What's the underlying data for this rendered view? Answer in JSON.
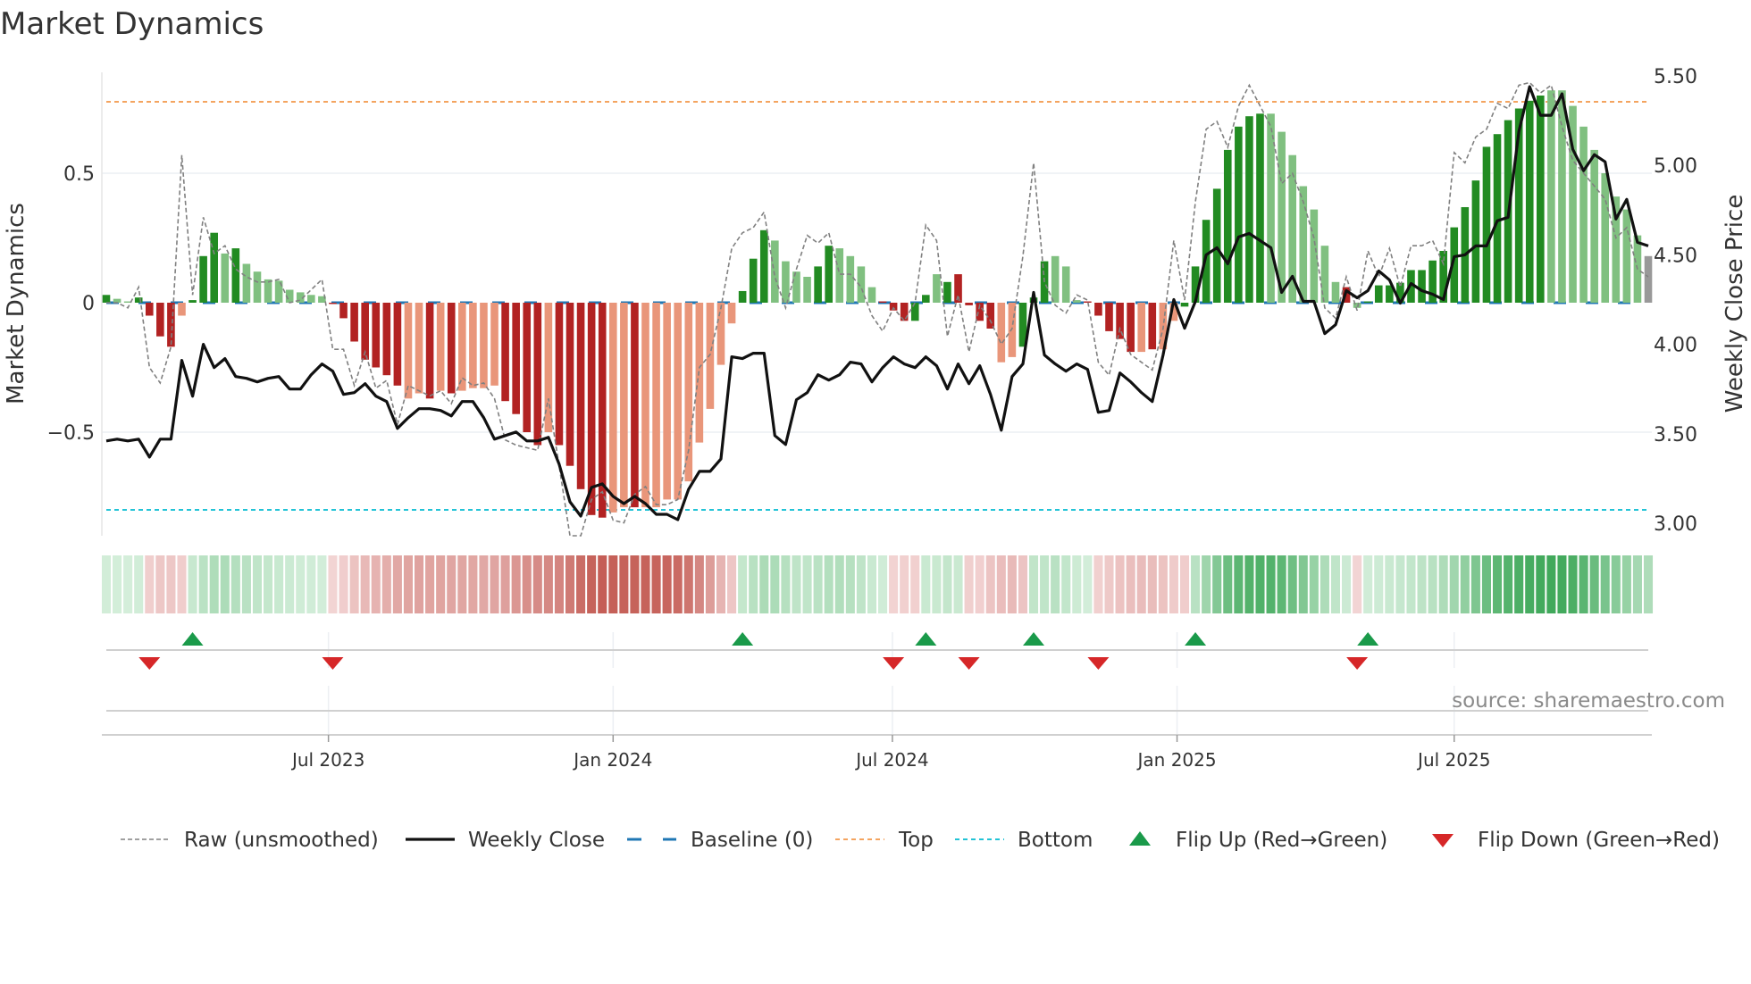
{
  "chart_data": {
    "type": "bar",
    "title": "Market Dynamics",
    "ylabel": "Market Dynamics",
    "y2label": "Weekly Close Price",
    "frequency": "weekly",
    "ylim": [
      -0.93,
      0.9
    ],
    "y2lim": [
      2.93,
      5.6
    ],
    "yticks": [
      {
        "v": 0.5,
        "label": "0.5"
      },
      {
        "v": 0,
        "label": "0"
      },
      {
        "v": -0.5,
        "label": "−0.5"
      }
    ],
    "y2ticks": [
      {
        "v": 5.5,
        "label": "5.50"
      },
      {
        "v": 5.0,
        "label": "5.00"
      },
      {
        "v": 4.5,
        "label": "4.50"
      },
      {
        "v": 4.0,
        "label": "4.00"
      },
      {
        "v": 3.5,
        "label": "3.50"
      },
      {
        "v": 3.0,
        "label": "3.00"
      }
    ],
    "xticks": [
      {
        "week": 20.6,
        "label": "Jul 2023"
      },
      {
        "week": 47.0,
        "label": "Jan 2024"
      },
      {
        "week": 72.9,
        "label": "Jul 2024"
      },
      {
        "week": 99.3,
        "label": "Jan 2025"
      },
      {
        "week": 125.0,
        "label": "Jul 2025"
      }
    ],
    "top_level": 0.776,
    "bottom_level": -0.8,
    "baseline": 0,
    "momentum": [
      0.03,
      0.015,
      0.005,
      0.02,
      -0.05,
      -0.13,
      -0.17,
      -0.05,
      0.01,
      0.18,
      0.27,
      0.19,
      0.21,
      0.15,
      0.12,
      0.09,
      0.085,
      0.05,
      0.04,
      0.03,
      0.025,
      -0.005,
      -0.06,
      -0.15,
      -0.22,
      -0.25,
      -0.28,
      -0.32,
      -0.37,
      -0.35,
      -0.37,
      -0.34,
      -0.35,
      -0.34,
      -0.33,
      -0.33,
      -0.32,
      -0.38,
      -0.43,
      -0.5,
      -0.55,
      -0.5,
      -0.55,
      -0.63,
      -0.72,
      -0.82,
      -0.83,
      -0.81,
      -0.79,
      -0.79,
      -0.79,
      -0.79,
      -0.76,
      -0.76,
      -0.69,
      -0.54,
      -0.41,
      -0.24,
      -0.08,
      0.045,
      0.17,
      0.28,
      0.24,
      0.16,
      0.12,
      0.1,
      0.14,
      0.22,
      0.21,
      0.18,
      0.14,
      0.06,
      0.005,
      -0.03,
      -0.07,
      -0.07,
      0.03,
      0.11,
      0.08,
      0.11,
      -0.01,
      -0.07,
      -0.1,
      -0.23,
      -0.21,
      -0.17,
      0.02,
      0.16,
      0.18,
      0.14,
      0.01,
      0.005,
      -0.05,
      -0.11,
      -0.14,
      -0.19,
      -0.19,
      -0.18,
      -0.18,
      -0.07,
      -0.015,
      0.14,
      0.32,
      0.44,
      0.59,
      0.68,
      0.72,
      0.73,
      0.73,
      0.66,
      0.57,
      0.45,
      0.36,
      0.22,
      0.08,
      0.06,
      -0.02,
      0.005,
      0.067,
      0.067,
      0.077,
      0.126,
      0.126,
      0.163,
      0.2,
      0.291,
      0.369,
      0.472,
      0.602,
      0.651,
      0.705,
      0.75,
      0.78,
      0.8,
      0.82,
      0.82,
      0.76,
      0.68,
      0.59,
      0.5,
      0.41,
      0.36,
      0.26,
      0.18
    ],
    "bar_state": "GggGRRRrGGGgGggggggggRRRRRRRrrRrRrrrrRRRRrRRRRRrrRrrrrrrrrrGGGggggGGggggRRRGGgGRRRRrrGGGgggRRRRRrRrrGGGGGGGGgggggggRgGGGGGGGGGGGGGGGGGggggggggg",
    "bar_state_legend": {
      "G": "green rising",
      "g": "green fading",
      "R": "red rising",
      "r": "red fading"
    },
    "raw": [
      0,
      0,
      -0.02,
      0.06,
      -0.25,
      -0.31,
      -0.17,
      0.57,
      0.03,
      0.33,
      0.19,
      0.22,
      0.13,
      0.1,
      0.08,
      0.08,
      0.09,
      0,
      0.01,
      0.05,
      0.09,
      -0.18,
      -0.18,
      -0.32,
      -0.19,
      -0.33,
      -0.3,
      -0.47,
      -0.32,
      -0.34,
      -0.36,
      -0.34,
      -0.39,
      -0.29,
      -0.32,
      -0.31,
      -0.37,
      -0.53,
      -0.55,
      -0.56,
      -0.57,
      -0.37,
      -0.63,
      -0.9,
      -0.9,
      -0.76,
      -0.73,
      -0.84,
      -0.85,
      -0.74,
      -0.71,
      -0.78,
      -0.78,
      -0.76,
      -0.57,
      -0.25,
      -0.2,
      -0.02,
      0.21,
      0.27,
      0.29,
      0.35,
      0.1,
      -0.02,
      0.13,
      0.26,
      0.23,
      0.27,
      0.11,
      0.11,
      0.06,
      -0.05,
      -0.11,
      -0.02,
      -0.07,
      0,
      0.3,
      0.24,
      -0.13,
      0.03,
      -0.19,
      -0.01,
      -0.07,
      -0.16,
      -0.1,
      0.18,
      0.54,
      0.08,
      -0.01,
      -0.04,
      0.03,
      0.01,
      -0.23,
      -0.28,
      -0.1,
      -0.2,
      -0.23,
      -0.26,
      -0.1,
      0.24,
      0.01,
      0.39,
      0.67,
      0.7,
      0.6,
      0.76,
      0.84,
      0.76,
      0.68,
      0.46,
      0.5,
      0.39,
      0.25,
      -0.02,
      -0.06,
      0.1,
      -0.03,
      0.2,
      0.1,
      0.21,
      0.06,
      0.22,
      0.22,
      0.24,
      0.15,
      0.58,
      0.54,
      0.64,
      0.67,
      0.77,
      0.75,
      0.84,
      0.85,
      0.81,
      0.84,
      0.68,
      0.55,
      0.5,
      0.45,
      0.4,
      0.25,
      0.29,
      0.13,
      0.1
    ],
    "close": [
      3.46,
      3.47,
      3.46,
      3.47,
      3.37,
      3.47,
      3.47,
      3.91,
      3.71,
      4.0,
      3.87,
      3.92,
      3.82,
      3.81,
      3.79,
      3.81,
      3.82,
      3.75,
      3.75,
      3.83,
      3.89,
      3.85,
      3.72,
      3.73,
      3.78,
      3.71,
      3.68,
      3.53,
      3.59,
      3.64,
      3.64,
      3.63,
      3.6,
      3.68,
      3.68,
      3.59,
      3.47,
      3.49,
      3.51,
      3.46,
      3.46,
      3.48,
      3.33,
      3.12,
      3.04,
      3.2,
      3.22,
      3.15,
      3.11,
      3.15,
      3.11,
      3.05,
      3.05,
      3.02,
      3.19,
      3.29,
      3.29,
      3.36,
      3.93,
      3.92,
      3.95,
      3.95,
      3.49,
      3.44,
      3.69,
      3.73,
      3.83,
      3.8,
      3.83,
      3.9,
      3.89,
      3.79,
      3.87,
      3.93,
      3.89,
      3.87,
      3.93,
      3.88,
      3.75,
      3.89,
      3.78,
      3.88,
      3.72,
      3.52,
      3.82,
      3.89,
      4.29,
      3.94,
      3.89,
      3.85,
      3.89,
      3.86,
      3.62,
      3.63,
      3.84,
      3.79,
      3.73,
      3.68,
      3.94,
      4.25,
      4.09,
      4.24,
      4.5,
      4.54,
      4.45,
      4.6,
      4.62,
      4.58,
      4.54,
      4.29,
      4.38,
      4.24,
      4.24,
      4.06,
      4.11,
      4.3,
      4.26,
      4.3,
      4.41,
      4.36,
      4.23,
      4.34,
      4.3,
      4.28,
      4.25,
      4.49,
      4.5,
      4.55,
      4.55,
      4.69,
      4.71,
      5.19,
      5.44,
      5.28,
      5.28,
      5.4,
      5.09,
      4.97,
      5.06,
      5.02,
      4.7,
      4.81,
      4.57,
      4.55
    ],
    "flip_up_weeks": [
      8,
      59,
      76,
      86,
      101,
      117
    ],
    "flip_down_weeks": [
      4,
      21,
      73,
      80,
      92,
      116
    ],
    "colors": {
      "green_dark": "#228b22",
      "green_light": "#80c080",
      "red_dark": "#b22222",
      "red_light": "#e9967a",
      "raw": "#808080",
      "close": "#111111",
      "baseline": "#1f77b4",
      "top": "#f4a460",
      "bottom": "#22c3d6",
      "flip_up": "#1a9a4a",
      "flip_down": "#d62728"
    },
    "legend": [
      {
        "key": "raw",
        "label": "Raw (unsmoothed)"
      },
      {
        "key": "close",
        "label": "Weekly Close"
      },
      {
        "key": "baseline",
        "label": "Baseline (0)"
      },
      {
        "key": "top",
        "label": "Top"
      },
      {
        "key": "bottom",
        "label": "Bottom"
      },
      {
        "key": "flip_up",
        "label": "Flip Up (Red→Green)"
      },
      {
        "key": "flip_down",
        "label": "Flip Down (Green→Red)"
      }
    ],
    "legend_placement": "bottom",
    "source": "source: sharemaestro.com"
  }
}
